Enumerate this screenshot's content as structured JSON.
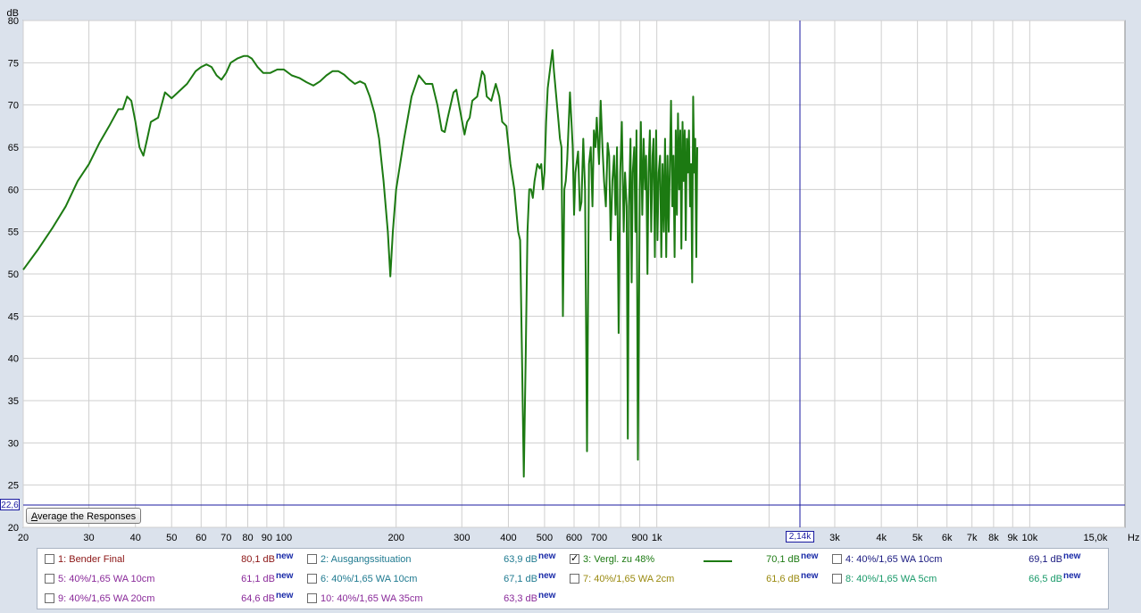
{
  "chart_data": {
    "type": "line",
    "x_scale": "log",
    "xlim": [
      20,
      18000
    ],
    "ylim": [
      20,
      80
    ],
    "ylabel": "dB",
    "x_unit": "Hz",
    "yticks": [
      "20",
      "25",
      "30",
      "35",
      "40",
      "45",
      "50",
      "55",
      "60",
      "65",
      "70",
      "75",
      "80"
    ],
    "xticks": [
      {
        "v": 20,
        "label": "20"
      },
      {
        "v": 30,
        "label": "30"
      },
      {
        "v": 40,
        "label": "40"
      },
      {
        "v": 50,
        "label": "50"
      },
      {
        "v": 60,
        "label": "60"
      },
      {
        "v": 70,
        "label": "70"
      },
      {
        "v": 80,
        "label": "80"
      },
      {
        "v": 90,
        "label": "90"
      },
      {
        "v": 100,
        "label": "100"
      },
      {
        "v": 200,
        "label": "200"
      },
      {
        "v": 300,
        "label": "300"
      },
      {
        "v": 400,
        "label": "400"
      },
      {
        "v": 500,
        "label": "500"
      },
      {
        "v": 600,
        "label": "600"
      },
      {
        "v": 700,
        "label": "700"
      },
      {
        "v": 900,
        "label": "900"
      },
      {
        "v": 1000,
        "label": "1k"
      },
      {
        "v": 3000,
        "label": "3k"
      },
      {
        "v": 4000,
        "label": "4k"
      },
      {
        "v": 5000,
        "label": "5k"
      },
      {
        "v": 6000,
        "label": "6k"
      },
      {
        "v": 7000,
        "label": "7k"
      },
      {
        "v": 8000,
        "label": "8k"
      },
      {
        "v": 9000,
        "label": "9k"
      },
      {
        "v": 10000,
        "label": "10k"
      },
      {
        "v": 15000,
        "label": "15,0k"
      }
    ],
    "series": [
      {
        "name": "3: Vergl. zu 48%",
        "color": "#1c7a12",
        "points": [
          [
            20,
            50.5
          ],
          [
            22,
            53
          ],
          [
            24,
            55.5
          ],
          [
            26,
            58
          ],
          [
            28,
            61
          ],
          [
            30,
            63
          ],
          [
            32,
            65.5
          ],
          [
            34,
            67.5
          ],
          [
            36,
            69.5
          ],
          [
            37,
            69.5
          ],
          [
            38,
            71
          ],
          [
            39,
            70.5
          ],
          [
            40,
            68
          ],
          [
            41,
            65
          ],
          [
            42,
            64
          ],
          [
            43,
            66
          ],
          [
            44,
            68
          ],
          [
            46,
            68.5
          ],
          [
            48,
            71.5
          ],
          [
            50,
            70.8
          ],
          [
            52,
            71.5
          ],
          [
            55,
            72.5
          ],
          [
            58,
            74
          ],
          [
            60,
            74.5
          ],
          [
            62,
            74.8
          ],
          [
            64,
            74.5
          ],
          [
            66,
            73.5
          ],
          [
            68,
            73
          ],
          [
            70,
            73.8
          ],
          [
            72,
            75
          ],
          [
            75,
            75.5
          ],
          [
            78,
            75.8
          ],
          [
            80,
            75.8
          ],
          [
            82,
            75.5
          ],
          [
            85,
            74.5
          ],
          [
            88,
            73.8
          ],
          [
            92,
            73.8
          ],
          [
            96,
            74.2
          ],
          [
            100,
            74.2
          ],
          [
            105,
            73.5
          ],
          [
            110,
            73.2
          ],
          [
            115,
            72.7
          ],
          [
            120,
            72.3
          ],
          [
            125,
            72.8
          ],
          [
            130,
            73.5
          ],
          [
            135,
            74
          ],
          [
            140,
            74
          ],
          [
            145,
            73.6
          ],
          [
            150,
            73
          ],
          [
            155,
            72.5
          ],
          [
            160,
            72.8
          ],
          [
            165,
            72.5
          ],
          [
            170,
            71
          ],
          [
            175,
            69
          ],
          [
            180,
            66
          ],
          [
            185,
            61
          ],
          [
            190,
            55
          ],
          [
            193,
            49.7
          ],
          [
            196,
            55
          ],
          [
            200,
            60
          ],
          [
            210,
            66
          ],
          [
            220,
            71
          ],
          [
            230,
            73.5
          ],
          [
            240,
            72.5
          ],
          [
            250,
            72.5
          ],
          [
            258,
            70
          ],
          [
            265,
            67
          ],
          [
            270,
            66.8
          ],
          [
            275,
            68.5
          ],
          [
            285,
            71.5
          ],
          [
            290,
            71.8
          ],
          [
            295,
            70
          ],
          [
            305,
            66.5
          ],
          [
            310,
            68
          ],
          [
            315,
            68.5
          ],
          [
            320,
            70.5
          ],
          [
            330,
            71
          ],
          [
            340,
            74
          ],
          [
            345,
            73.5
          ],
          [
            350,
            71
          ],
          [
            360,
            70.5
          ],
          [
            370,
            72.5
          ],
          [
            378,
            71
          ],
          [
            385,
            68
          ],
          [
            395,
            67.5
          ],
          [
            405,
            63
          ],
          [
            415,
            60
          ],
          [
            425,
            55
          ],
          [
            430,
            54
          ],
          [
            435,
            40
          ],
          [
            440,
            26
          ],
          [
            445,
            40
          ],
          [
            450,
            55
          ],
          [
            455,
            60
          ],
          [
            460,
            60
          ],
          [
            465,
            59
          ],
          [
            470,
            61
          ],
          [
            478,
            63
          ],
          [
            485,
            62.5
          ],
          [
            490,
            63
          ],
          [
            495,
            60
          ],
          [
            500,
            62
          ],
          [
            505,
            68
          ],
          [
            510,
            72
          ],
          [
            520,
            75
          ],
          [
            525,
            76.5
          ],
          [
            530,
            74
          ],
          [
            540,
            70
          ],
          [
            545,
            68
          ],
          [
            550,
            66
          ],
          [
            555,
            65
          ],
          [
            560,
            45
          ],
          [
            565,
            60
          ],
          [
            570,
            61
          ],
          [
            575,
            63.5
          ],
          [
            585,
            71.5
          ],
          [
            595,
            65
          ],
          [
            600,
            57
          ],
          [
            605,
            62
          ],
          [
            615,
            64.5
          ],
          [
            622,
            57.5
          ],
          [
            628,
            58.5
          ],
          [
            635,
            66
          ],
          [
            642,
            60
          ],
          [
            650,
            29
          ],
          [
            658,
            63
          ],
          [
            665,
            65
          ],
          [
            672,
            58
          ],
          [
            678,
            67
          ],
          [
            685,
            65
          ],
          [
            690,
            68.5
          ],
          [
            700,
            63
          ],
          [
            707,
            70.5
          ],
          [
            715,
            65
          ],
          [
            722,
            61
          ],
          [
            730,
            58
          ],
          [
            738,
            65.5
          ],
          [
            745,
            64
          ],
          [
            752,
            54
          ],
          [
            760,
            61
          ],
          [
            768,
            64
          ],
          [
            775,
            57
          ],
          [
            782,
            65
          ],
          [
            790,
            43
          ],
          [
            798,
            62
          ],
          [
            806,
            68
          ],
          [
            815,
            55
          ],
          [
            822,
            62
          ],
          [
            830,
            58
          ],
          [
            836,
            30.5
          ],
          [
            842,
            58
          ],
          [
            850,
            66
          ],
          [
            856,
            49
          ],
          [
            862,
            62
          ],
          [
            870,
            65
          ],
          [
            876,
            55
          ],
          [
            882,
            67
          ],
          [
            890,
            28
          ],
          [
            900,
            60
          ],
          [
            906,
            68
          ],
          [
            914,
            57
          ],
          [
            922,
            66
          ],
          [
            930,
            60
          ],
          [
            936,
            64
          ],
          [
            944,
            50
          ],
          [
            950,
            62
          ],
          [
            958,
            67
          ],
          [
            966,
            55
          ],
          [
            974,
            64
          ],
          [
            980,
            66
          ],
          [
            988,
            52
          ],
          [
            996,
            67
          ],
          [
            1004,
            54
          ],
          [
            1012,
            62
          ],
          [
            1020,
            64
          ],
          [
            1028,
            52
          ],
          [
            1036,
            63
          ],
          [
            1044,
            55
          ],
          [
            1052,
            66
          ],
          [
            1060,
            52
          ],
          [
            1068,
            64
          ],
          [
            1076,
            55
          ],
          [
            1084,
            63
          ],
          [
            1092,
            70.5
          ],
          [
            1100,
            58
          ],
          [
            1108,
            64
          ],
          [
            1116,
            52
          ],
          [
            1124,
            67
          ],
          [
            1132,
            57
          ],
          [
            1140,
            69
          ],
          [
            1148,
            60
          ],
          [
            1156,
            67
          ],
          [
            1164,
            53
          ],
          [
            1172,
            68
          ],
          [
            1180,
            61
          ],
          [
            1188,
            67
          ],
          [
            1196,
            54
          ],
          [
            1204,
            66
          ],
          [
            1212,
            62
          ],
          [
            1220,
            67
          ],
          [
            1228,
            58
          ],
          [
            1236,
            63
          ],
          [
            1244,
            49
          ],
          [
            1252,
            71
          ],
          [
            1260,
            62
          ],
          [
            1268,
            66
          ],
          [
            1276,
            52
          ],
          [
            1284,
            65
          ]
        ]
      }
    ]
  },
  "cursor": {
    "x_readout": "2,14k",
    "y_readout": "22,6"
  },
  "button": {
    "avg_label_u": "A",
    "avg_label_rest": "verage the Responses"
  },
  "legend": [
    {
      "name": "1: Bender Final",
      "value": "80,1 dB",
      "new": "new",
      "checked": false,
      "color": "#8b1414"
    },
    {
      "name": "2: Ausgangssituation",
      "value": "63,9 dB",
      "new": "new",
      "checked": false,
      "color": "#1f7a90"
    },
    {
      "name": "3: Vergl. zu 48%",
      "value": "70,1 dB",
      "new": "new",
      "checked": true,
      "color": "#1c7a12"
    },
    {
      "name": "4: 40%/1,65 WA 10cm",
      "value": "69,1 dB",
      "new": "new",
      "checked": false,
      "color": "#1a1a80"
    },
    {
      "name": "5: 40%/1,65 WA 10cm",
      "value": "61,1 dB",
      "new": "new",
      "checked": false,
      "color": "#8a2a9a"
    },
    {
      "name": "6: 40%/1,65 WA 10cm",
      "value": "67,1 dB",
      "new": "new",
      "checked": false,
      "color": "#1f7a90"
    },
    {
      "name": "7: 40%/1,65 WA 2cm",
      "value": "61,6 dB",
      "new": "new",
      "checked": false,
      "color": "#9a8a10"
    },
    {
      "name": "8: 40%/1,65 WA 5cm",
      "value": "66,5 dB",
      "new": "new",
      "checked": false,
      "color": "#1a9a6a"
    },
    {
      "name": "9: 40%/1,65 WA 20cm",
      "value": "64,6 dB",
      "new": "new",
      "checked": false,
      "color": "#8a2a9a"
    },
    {
      "name": "10: 40%/1,65 WA 35cm",
      "value": "63,3 dB",
      "new": "new",
      "checked": false,
      "color": "#8a2a9a"
    }
  ]
}
